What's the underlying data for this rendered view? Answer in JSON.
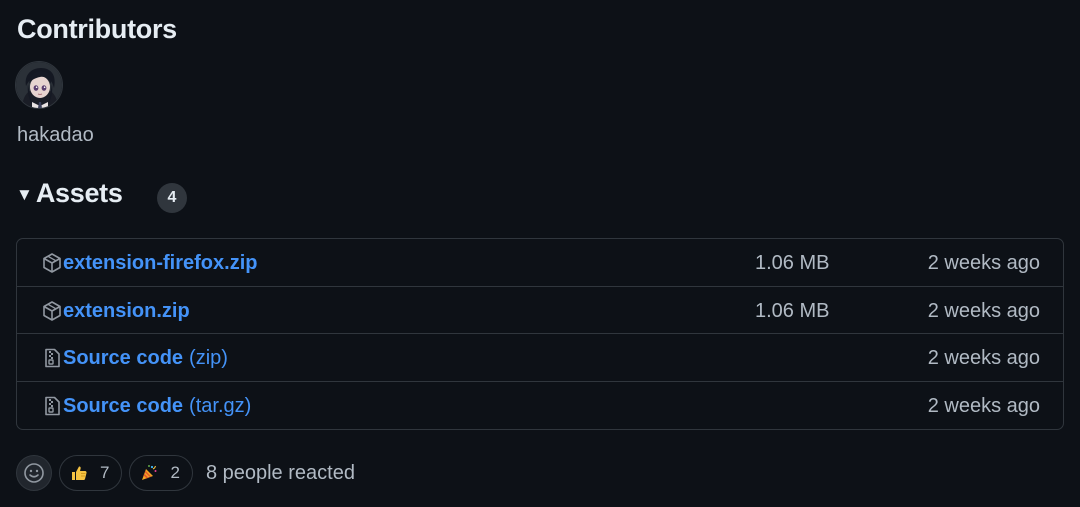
{
  "contributors": {
    "title": "Contributors",
    "items": [
      {
        "name": "hakadao"
      }
    ]
  },
  "assets": {
    "toggle_icon": "triangle-down-icon",
    "title": "Assets",
    "count": "4",
    "rows": [
      {
        "icon": "package-icon",
        "name": "extension-firefox.zip",
        "suffix": "",
        "size": "1.06 MB",
        "date": "2 weeks ago"
      },
      {
        "icon": "package-icon",
        "name": "extension.zip",
        "suffix": "",
        "size": "1.06 MB",
        "date": "2 weeks ago"
      },
      {
        "icon": "file-zip-icon",
        "name": "Source code",
        "suffix": "(zip)",
        "size": "",
        "date": "2 weeks ago"
      },
      {
        "icon": "file-zip-icon",
        "name": "Source code",
        "suffix": "(tar.gz)",
        "size": "",
        "date": "2 weeks ago"
      }
    ]
  },
  "reactions": {
    "add_icon": "smiley-icon",
    "items": [
      {
        "emoji": "thumbs-up-icon",
        "count": "7"
      },
      {
        "emoji": "party-popper-icon",
        "count": "2"
      }
    ],
    "summary": "8 people reacted"
  },
  "colors": {
    "background": "#0d1117",
    "link": "#4493f8",
    "border": "#30363d",
    "muted_text": "#b1bac4"
  }
}
